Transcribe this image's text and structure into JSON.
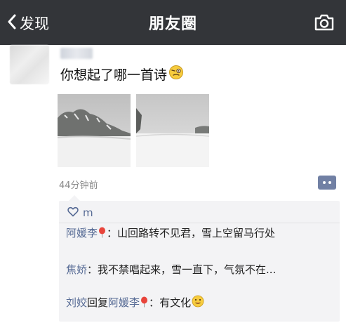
{
  "header": {
    "back_label": "发现",
    "title": "朋友圈"
  },
  "post": {
    "text": "你想起了哪一首诗",
    "time": "44分钟前",
    "likes": "m",
    "comments": [
      {
        "author": "阿媛李",
        "separator": "：",
        "text": "山回路转不见君，雪上空留马行处"
      },
      {
        "author": "焦娇",
        "separator": "：",
        "text": "我不禁唱起来，雪一直下，气氛不在..."
      },
      {
        "author": "刘姣",
        "reply_word": "回复",
        "reply_to": "阿媛李",
        "separator": "：",
        "text": "有文化"
      }
    ]
  },
  "icons": {
    "back": "chevron-left-icon",
    "camera": "camera-icon",
    "like": "heart-icon",
    "more": "comment-more-icon",
    "balloon": "balloon-icon",
    "emoji": "emoji-icon"
  },
  "colors": {
    "topbar": "#333539",
    "name_link": "#576b95",
    "comment_bg": "#f3f3f5",
    "balloon": "#e8443b"
  }
}
